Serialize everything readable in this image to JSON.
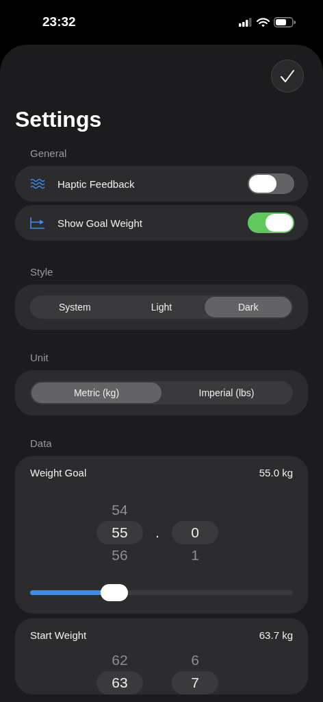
{
  "status_bar": {
    "time": "23:32"
  },
  "title": "Settings",
  "general": {
    "title": "General",
    "rows": [
      {
        "label": "Haptic Feedback",
        "on": false
      },
      {
        "label": "Show Goal Weight",
        "on": true
      }
    ]
  },
  "style": {
    "title": "Style",
    "options": [
      {
        "label": "System",
        "selected": false
      },
      {
        "label": "Light",
        "selected": false
      },
      {
        "label": "Dark",
        "selected": true
      }
    ]
  },
  "unit": {
    "title": "Unit",
    "options": [
      {
        "label": "Metric (kg)",
        "selected": true
      },
      {
        "label": "Imperial (lbs)",
        "selected": false
      }
    ]
  },
  "data": {
    "title": "Data",
    "cards": [
      {
        "label": "Weight Goal",
        "value": "55.0 kg",
        "whole": [
          {
            "text": "54",
            "selected": false
          },
          {
            "text": "55",
            "selected": true
          },
          {
            "text": "56",
            "selected": false
          }
        ],
        "separator": ".",
        "fraction": [
          {
            "text": "0",
            "selected": true
          },
          {
            "text": "1",
            "selected": false
          }
        ],
        "slider": {
          "level": 0.32
        }
      },
      {
        "label": "Start Weight",
        "value": "63.7 kg",
        "whole": [
          {
            "text": "62",
            "selected": false
          },
          {
            "text": "63",
            "selected": true
          }
        ],
        "fraction": [
          {
            "text": "6",
            "selected": false
          },
          {
            "text": "7",
            "selected": true
          }
        ]
      }
    ]
  }
}
